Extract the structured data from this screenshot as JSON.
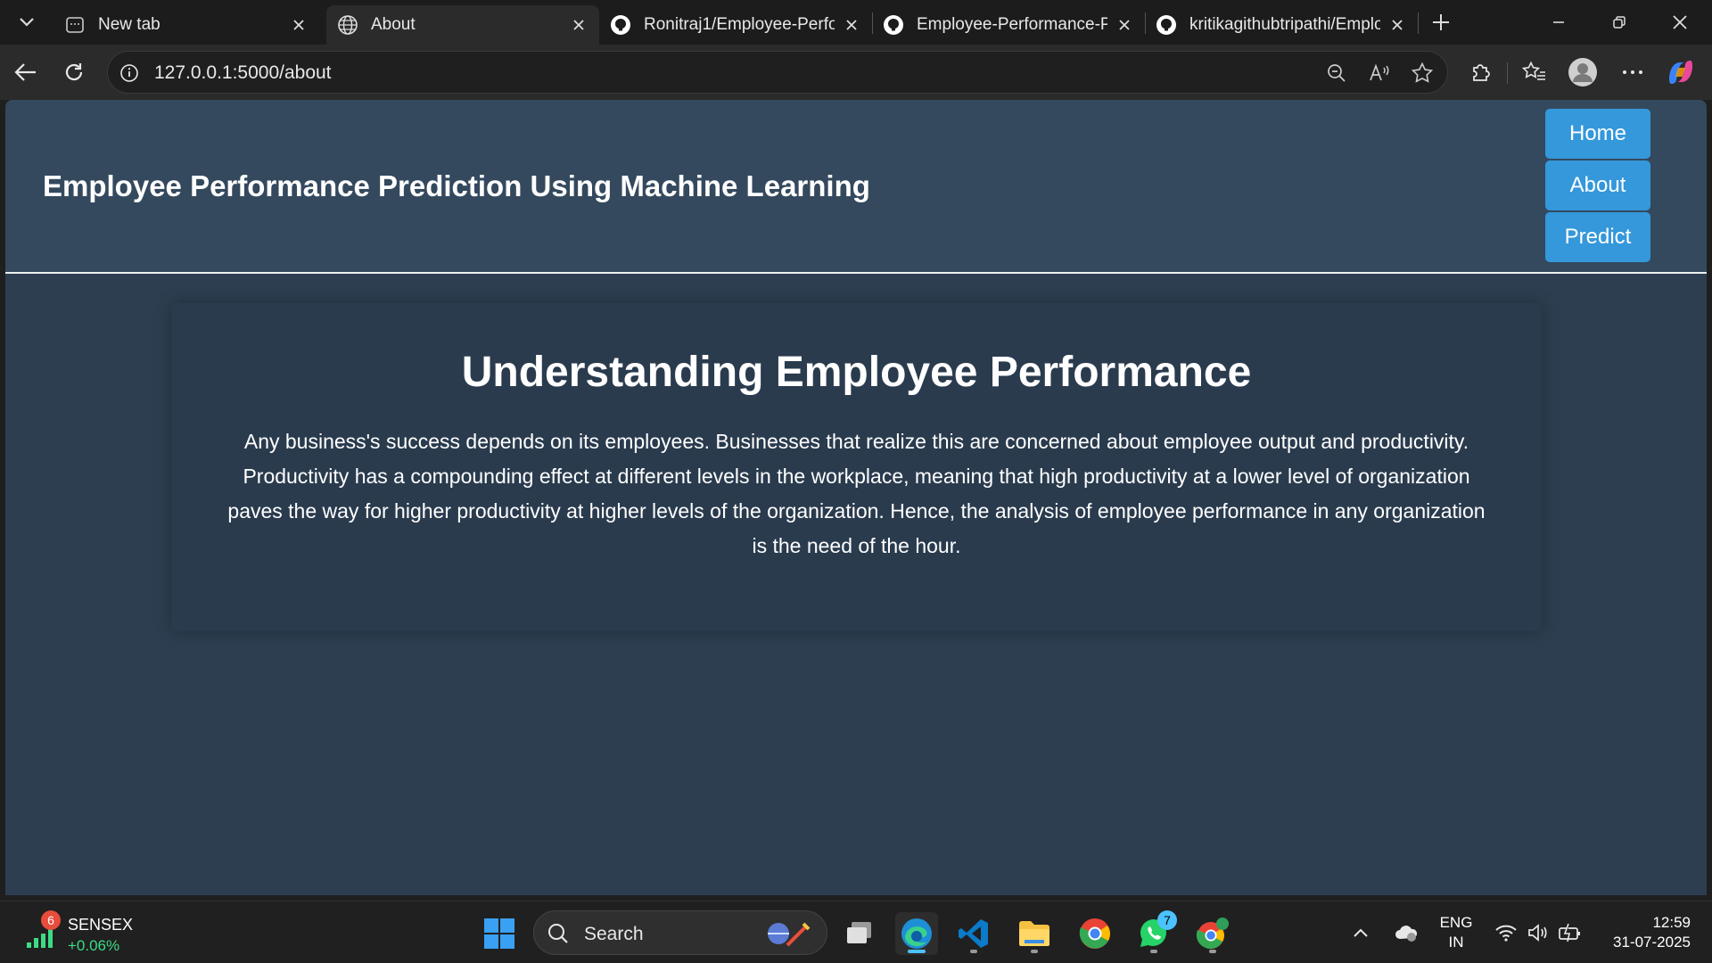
{
  "browser": {
    "tabs": [
      {
        "title": "New tab",
        "active": false,
        "icon": "new-tab-icon"
      },
      {
        "title": "About",
        "active": true,
        "icon": "globe-icon"
      },
      {
        "title": "Ronitraj1/Employee-Perfor",
        "active": false,
        "icon": "github-icon"
      },
      {
        "title": "Employee-Performance-Pre",
        "active": false,
        "icon": "github-icon"
      },
      {
        "title": "kritikagithubtripathi/Emplo",
        "active": false,
        "icon": "github-icon"
      }
    ],
    "url": "127.0.0.1:5000/about"
  },
  "site": {
    "title": "Employee Performance Prediction Using Machine Learning",
    "nav": [
      "Home",
      "About",
      "Predict"
    ],
    "heading": "Understanding Employee Performance",
    "paragraph": "Any business's success depends on its employees. Businesses that realize this are concerned about employee output and productivity. Productivity has a compounding effect at different levels in the workplace, meaning that high productivity at a lower level of organization paves the way for higher productivity at higher levels of the organization. Hence, the analysis of employee performance in any organization is the need of the hour.",
    "colors": {
      "header": "#34495e",
      "body": "#2c3e50",
      "nav_button": "#3498db"
    }
  },
  "taskbar": {
    "widget": {
      "badge": "6",
      "name": "SENSEX",
      "change": "+0.06%"
    },
    "search_label": "Search",
    "whatsapp_badge": "7",
    "language": "ENG",
    "region": "IN",
    "time": "12:59",
    "date": "31-07-2025"
  }
}
